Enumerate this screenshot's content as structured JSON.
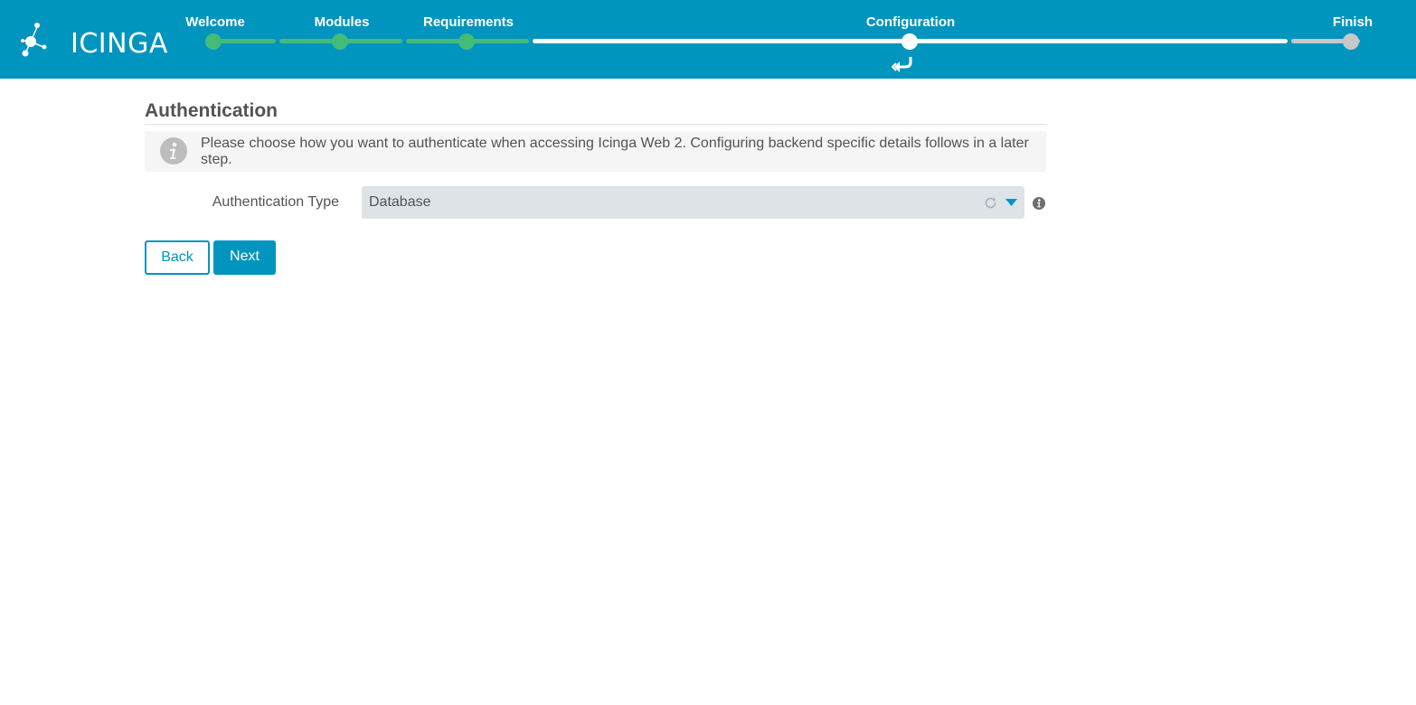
{
  "brand": {
    "logo_text": "ICINGA"
  },
  "wizard": {
    "steps": [
      {
        "label": "Welcome",
        "status": "done"
      },
      {
        "label": "Modules",
        "status": "done"
      },
      {
        "label": "Requirements",
        "status": "done"
      },
      {
        "label": "Configuration",
        "status": "current"
      },
      {
        "label": "Finish",
        "status": "todo"
      }
    ]
  },
  "page": {
    "title": "Authentication",
    "info": "Please choose how you want to authenticate when accessing Icinga Web 2. Configuring backend specific details follows in a later step."
  },
  "form": {
    "auth_type_label": "Authentication Type",
    "auth_type_value": "Database"
  },
  "buttons": {
    "back": "Back",
    "next": "Next"
  },
  "colors": {
    "header": "#0095bf",
    "done": "#44bb77",
    "current": "#ffffff",
    "todo": "#c8c8c8",
    "select_bg": "#dde3e7"
  }
}
